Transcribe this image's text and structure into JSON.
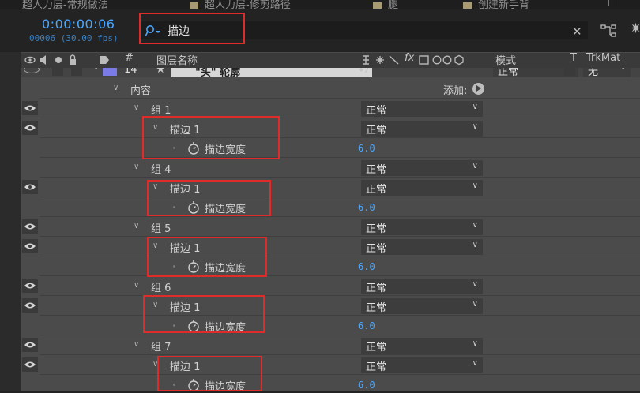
{
  "tabs": [
    {
      "label": "超人力层-常规做法"
    },
    {
      "label": "超人力层-修剪路径"
    },
    {
      "label": "腿"
    },
    {
      "label": "创建新手背"
    }
  ],
  "header": {
    "timecode": "0:00:00:06",
    "frames": "00006 (30.00 fps)",
    "search_value": "描边"
  },
  "columns": {
    "layer_name": "图层名称",
    "hash": "#",
    "fx": "fx",
    "mode": "模式",
    "t": "T",
    "trkmat": "TrkMat"
  },
  "layer": {
    "number": "14",
    "name": "\"头\" 轮廓",
    "mode": "正常",
    "trkmat": "无"
  },
  "contents": {
    "label": "内容",
    "add_label": "添加:"
  },
  "rows": [
    {
      "group": "组 1",
      "stroke": "描边 1",
      "prop": "描边宽度",
      "mode": "正常",
      "value": "6.0"
    },
    {
      "group": "组 4",
      "stroke": "描边 1",
      "prop": "描边宽度",
      "mode": "正常",
      "value": "6.0"
    },
    {
      "group": "组 5",
      "stroke": "描边 1",
      "prop": "描边宽度",
      "mode": "正常",
      "value": "6.0"
    },
    {
      "group": "组 6",
      "stroke": "描边 1",
      "prop": "描边宽度",
      "mode": "正常",
      "value": "6.0"
    },
    {
      "group": "组 7",
      "stroke": "描边 1",
      "prop": "描边宽度",
      "mode": "正常",
      "value": "6.0"
    }
  ],
  "colors": {
    "accent": "#4aa7ff",
    "highlight": "#e02b2b",
    "panel": "#4b4b4b"
  }
}
